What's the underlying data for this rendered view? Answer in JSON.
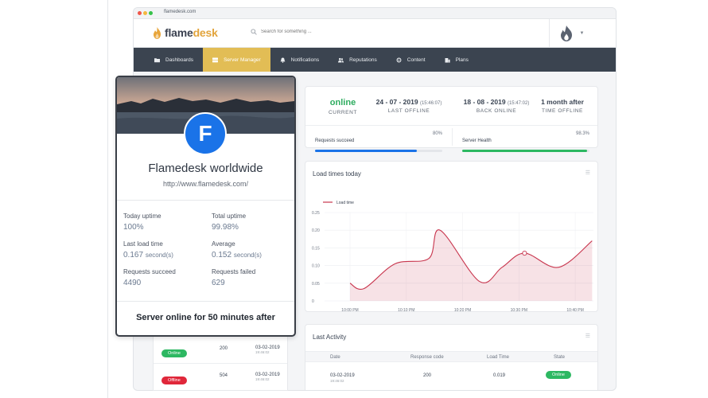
{
  "browser": {
    "url": "flamedesk.com"
  },
  "header": {
    "logo_main": "flame",
    "logo_accent": "desk",
    "search_placeholder": "Search for something ..."
  },
  "nav": {
    "items": [
      {
        "label": "Dashboards",
        "icon": "folder-icon",
        "active": false
      },
      {
        "label": "Server Manager",
        "icon": "server-icon",
        "active": true
      },
      {
        "label": "Notifications",
        "icon": "bell-icon",
        "active": false
      },
      {
        "label": "Reputations",
        "icon": "users-icon",
        "active": false
      },
      {
        "label": "Content",
        "icon": "gear-icon",
        "active": false
      },
      {
        "label": "Plans",
        "icon": "building-icon",
        "active": false
      }
    ]
  },
  "status": {
    "current": {
      "value": "online",
      "label": "CURRENT"
    },
    "last_offline": {
      "date": "24 - 07 - 2019",
      "time": "(15:46:07)",
      "label": "LAST OFFLINE"
    },
    "back_online": {
      "date": "18 - 08 - 2019",
      "time": "(15:47:02)",
      "label": "BACK ONLINE"
    },
    "time_offline": {
      "value": "1 month after",
      "label": "TIME OFFLINE"
    },
    "requests": {
      "label": "Requests succeed",
      "value": "80%",
      "fraction": 0.8,
      "color": "#1a73e8"
    },
    "health": {
      "label": "Server Health",
      "value": "98.3%",
      "fraction": 0.983,
      "color": "#2db862"
    }
  },
  "chart_card": {
    "title": "Load times today"
  },
  "chart_data": {
    "type": "area",
    "series": [
      {
        "name": "Load time",
        "color": "#c8354d"
      }
    ],
    "x": [
      "10:00 PM",
      "10:10 PM",
      "10:20 PM",
      "10:30 PM",
      "10:40 PM"
    ],
    "points": [
      [
        0,
        0.05
      ],
      [
        0.25,
        0.035
      ],
      [
        0.8,
        0.105
      ],
      [
        1.4,
        0.12
      ],
      [
        1.6,
        0.2
      ],
      [
        2.3,
        0.055
      ],
      [
        2.7,
        0.095
      ],
      [
        3.1,
        0.135
      ],
      [
        3.7,
        0.095
      ],
      [
        4.3,
        0.17
      ]
    ],
    "highlight_x": 3.1,
    "ylim": [
      0,
      0.25
    ],
    "yticks": [
      "0",
      "0.05",
      "0.10",
      "0.15",
      "0.20",
      "0.25"
    ],
    "grid": true,
    "legend": "top-left"
  },
  "activity": {
    "title": "Last Activity",
    "columns": [
      "Date",
      "Response code",
      "Load Time",
      "State"
    ],
    "rows": [
      {
        "date": "03-02-2019",
        "time": "19:46:02",
        "code": "200",
        "load": "0.019",
        "state": "Online"
      }
    ]
  },
  "under_list": {
    "rows": [
      {
        "state": "Online",
        "code": "200",
        "date": "03-02-2019",
        "time": "19:46:02"
      },
      {
        "state": "Offline",
        "code": "504",
        "date": "03-02-2019",
        "time": "19:46:02"
      }
    ]
  },
  "profile": {
    "initial": "F",
    "name": "Flamedesk worldwide",
    "url": "http://www.flamedesk.com/",
    "metrics": [
      {
        "label": "Today uptime",
        "value": "100%",
        "unit": ""
      },
      {
        "label": "Total uptime",
        "value": "99.98%",
        "unit": ""
      },
      {
        "label": "Last load time",
        "value": "0.167",
        "unit": "second(s)"
      },
      {
        "label": "Average",
        "value": "0.152",
        "unit": "second(s)"
      },
      {
        "label": "Requests succeed",
        "value": "4490",
        "unit": ""
      },
      {
        "label": "Requests failed",
        "value": "629",
        "unit": ""
      }
    ],
    "footer": "Server online for 50 minutes after"
  },
  "colors": {
    "accent": "#e2bd55",
    "nav_bg": "#3b4450",
    "online": "#2db862",
    "offline": "#e0273a"
  }
}
